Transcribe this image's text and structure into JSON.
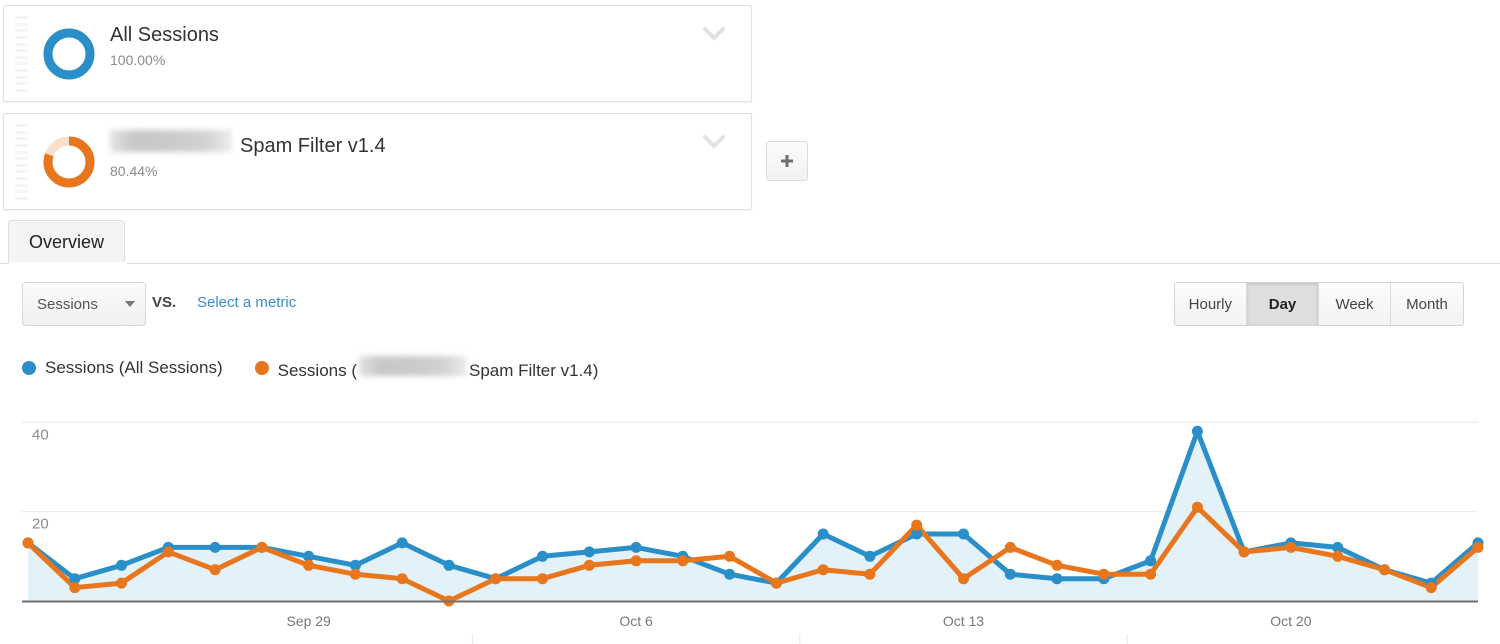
{
  "segments": [
    {
      "name": "All Sessions",
      "percent": "100.00%",
      "color": "#2a8fc8",
      "fill_fraction": 1.0,
      "redacted_prefix": false,
      "chevron_icon": "chevron-down-icon",
      "drag_icon": "drag-handle-icon"
    },
    {
      "name": "Spam Filter v1.4",
      "percent": "80.44%",
      "color": "#e8761c",
      "fill_fraction": 0.8044,
      "redacted_prefix": true,
      "chevron_icon": "chevron-down-icon",
      "drag_icon": "drag-handle-icon"
    }
  ],
  "add_segment": {
    "label": "+",
    "icon": "plus-icon"
  },
  "tabs": [
    {
      "label": "Overview",
      "active": true
    }
  ],
  "metric_controls": {
    "selected_metric": "Sessions",
    "vs_label": "VS.",
    "select_metric_link": "Select a metric",
    "caret_icon": "chevron-down-icon"
  },
  "granularity": {
    "options": [
      "Hourly",
      "Day",
      "Week",
      "Month"
    ],
    "selected": "Day"
  },
  "legend": [
    {
      "label": "Sessions (All Sessions)",
      "color": "#2a8fc8",
      "redacted": false
    },
    {
      "label_before": "Sessions (",
      "label_after": "Spam Filter v1.4)",
      "color": "#e8761c",
      "redacted": true
    }
  ],
  "colors": {
    "series_blue": "#2a8fc8",
    "series_orange": "#e8761c",
    "area_fill": "#e3f1f8",
    "grid": "#eaeaea",
    "axis": "#6f6f6f"
  },
  "chart_data": {
    "type": "line",
    "title": "",
    "xlabel": "",
    "ylabel": "",
    "ylim": [
      0,
      45
    ],
    "yticks": [
      20,
      40
    ],
    "ytick_labels": [
      "20",
      "40"
    ],
    "grid": true,
    "legend_position": "top-left",
    "area_fill_series": "Sessions (All Sessions)",
    "x": [
      "Sep 23",
      "Sep 24",
      "Sep 25",
      "Sep 26",
      "Sep 27",
      "Sep 28",
      "Sep 29",
      "Sep 30",
      "Oct 1",
      "Oct 2",
      "Oct 3",
      "Oct 4",
      "Oct 5",
      "Oct 6",
      "Oct 7",
      "Oct 8",
      "Oct 9",
      "Oct 10",
      "Oct 11",
      "Oct 12",
      "Oct 13",
      "Oct 14",
      "Oct 15",
      "Oct 16",
      "Oct 17",
      "Oct 18",
      "Oct 19",
      "Oct 20",
      "Oct 21",
      "Oct 22",
      "Oct 23",
      "Oct 24"
    ],
    "xtick_labels": [
      "Sep 29",
      "Oct 6",
      "Oct 13",
      "Oct 20"
    ],
    "xtick_indices": [
      6,
      13,
      20,
      27
    ],
    "series": [
      {
        "name": "Sessions (All Sessions)",
        "color": "#2a8fc8",
        "values": [
          13,
          5,
          8,
          12,
          12,
          12,
          10,
          8,
          13,
          8,
          5,
          10,
          11,
          12,
          10,
          6,
          4,
          15,
          10,
          15,
          15,
          6,
          5,
          5,
          9,
          38,
          11,
          13,
          12,
          7,
          4,
          13
        ]
      },
      {
        "name": "Sessions (Spam Filter v1.4)",
        "color": "#e8761c",
        "values": [
          13,
          3,
          4,
          11,
          7,
          12,
          8,
          6,
          5,
          0,
          5,
          5,
          8,
          9,
          9,
          10,
          4,
          7,
          6,
          17,
          5,
          12,
          8,
          6,
          6,
          21,
          11,
          12,
          10,
          7,
          3,
          12
        ]
      }
    ]
  }
}
